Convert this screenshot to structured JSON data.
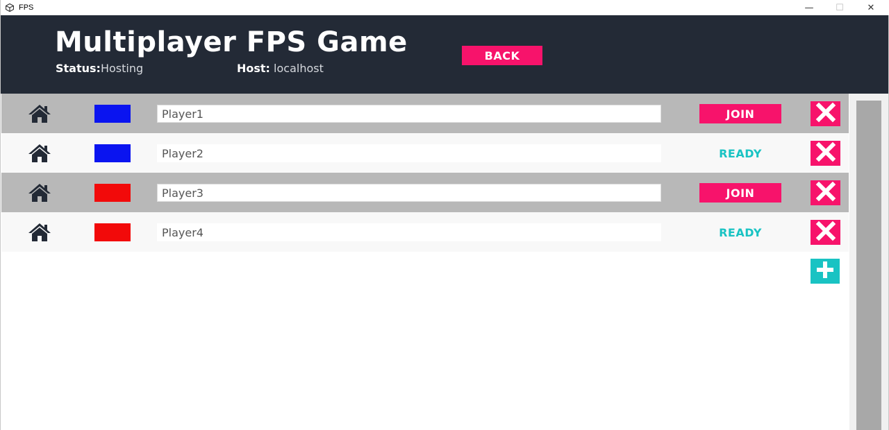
{
  "window": {
    "title": "FPS",
    "icon": "unity-logo-icon",
    "minimize_glyph": "—",
    "maximize_glyph": "☐",
    "close_glyph": "✕"
  },
  "header": {
    "title": "Multiplayer FPS Game",
    "status_label": "Status:",
    "status_value": "Hosting",
    "host_label": "Host:",
    "host_value": "localhost",
    "back_label": "BACK"
  },
  "colors": {
    "header_bg": "#232a36",
    "accent_pink": "#f7136b",
    "accent_teal": "#19c3c3",
    "host_row_bg": "#b8b8b8",
    "guest_row_bg": "#f8f8f8",
    "team_blue": "#0a14f0",
    "team_red": "#f20a0a"
  },
  "players": [
    {
      "name": "Player1",
      "team_color": "#0a14f0",
      "state": "join",
      "action_label": "JOIN",
      "row_type": "host-row"
    },
    {
      "name": "Player2",
      "team_color": "#0a14f0",
      "state": "ready",
      "action_label": "READY",
      "row_type": "guest-row"
    },
    {
      "name": "Player3",
      "team_color": "#f20a0a",
      "state": "join",
      "action_label": "JOIN",
      "row_type": "host-row"
    },
    {
      "name": "Player4",
      "team_color": "#f20a0a",
      "state": "ready",
      "action_label": "READY",
      "row_type": "guest-row"
    }
  ],
  "icons": {
    "row_icon": "home-icon",
    "remove": "close-icon",
    "add": "plus-icon"
  }
}
